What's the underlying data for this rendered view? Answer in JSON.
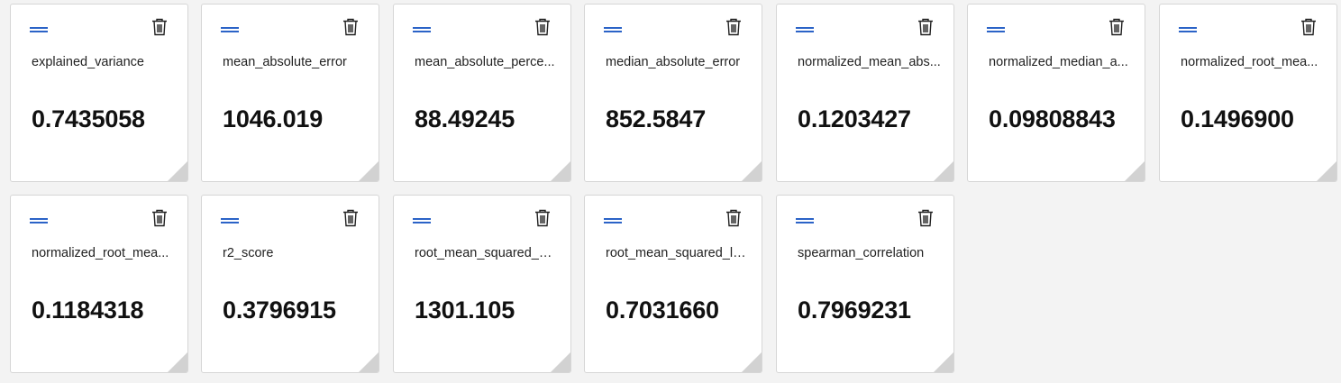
{
  "cards": [
    {
      "name": "explained_variance",
      "value": "0.7435058"
    },
    {
      "name": "mean_absolute_error",
      "value": "1046.019"
    },
    {
      "name": "mean_absolute_perce...",
      "value": "88.49245"
    },
    {
      "name": "median_absolute_error",
      "value": "852.5847"
    },
    {
      "name": "normalized_mean_abs...",
      "value": "0.1203427"
    },
    {
      "name": "normalized_median_a...",
      "value": "0.09808843"
    },
    {
      "name": "normalized_root_mea...",
      "value": "0.1496900"
    },
    {
      "name": "normalized_root_mea...",
      "value": "0.1184318"
    },
    {
      "name": "r2_score",
      "value": "0.3796915"
    },
    {
      "name": "root_mean_squared_er...",
      "value": "1301.105"
    },
    {
      "name": "root_mean_squared_lo...",
      "value": "0.7031660"
    },
    {
      "name": "spearman_correlation",
      "value": "0.7969231"
    }
  ],
  "icons": {
    "drag": "drag-handle-icon",
    "delete": "trash-icon",
    "resize": "resize-grip-icon"
  },
  "colors": {
    "accent": "#2b63c7",
    "background": "#f3f3f3",
    "card": "#ffffff"
  }
}
